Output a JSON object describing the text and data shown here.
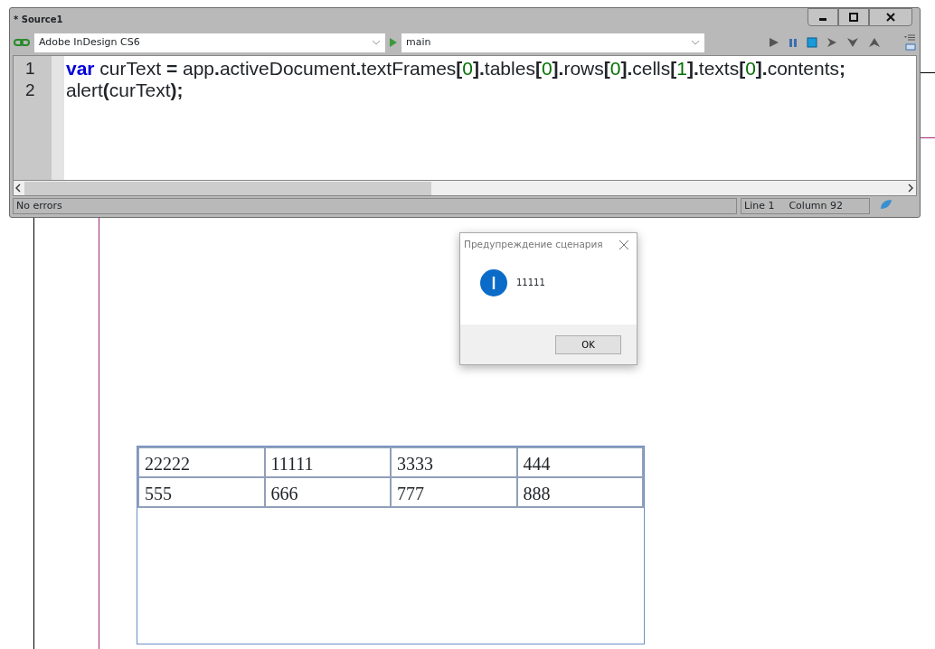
{
  "editor_window": {
    "title": "* Source1",
    "target_app": {
      "value": "Adobe InDesign CS6"
    },
    "function": {
      "value": "main"
    },
    "code_lines": [
      {
        "number": "1",
        "tokens": [
          {
            "text": "var",
            "kind": "keyword"
          },
          {
            "text": " curText ",
            "kind": "plain"
          },
          {
            "text": "=",
            "kind": "punct"
          },
          {
            "text": " app",
            "kind": "plain"
          },
          {
            "text": ".",
            "kind": "punct"
          },
          {
            "text": "activeDocument",
            "kind": "plain"
          },
          {
            "text": ".",
            "kind": "punct"
          },
          {
            "text": "textFrames",
            "kind": "plain"
          },
          {
            "text": "[",
            "kind": "punct"
          },
          {
            "text": "0",
            "kind": "number"
          },
          {
            "text": "].",
            "kind": "punct"
          },
          {
            "text": "tables",
            "kind": "plain"
          },
          {
            "text": "[",
            "kind": "punct"
          },
          {
            "text": "0",
            "kind": "number"
          },
          {
            "text": "].",
            "kind": "punct"
          },
          {
            "text": "rows",
            "kind": "plain"
          },
          {
            "text": "[",
            "kind": "punct"
          },
          {
            "text": "0",
            "kind": "number"
          },
          {
            "text": "].",
            "kind": "punct"
          },
          {
            "text": "cells",
            "kind": "plain"
          },
          {
            "text": "[",
            "kind": "punct"
          },
          {
            "text": "1",
            "kind": "number"
          },
          {
            "text": "].",
            "kind": "punct"
          },
          {
            "text": "texts",
            "kind": "plain"
          },
          {
            "text": "[",
            "kind": "punct"
          },
          {
            "text": "0",
            "kind": "number"
          },
          {
            "text": "].",
            "kind": "punct"
          },
          {
            "text": "contents",
            "kind": "plain"
          },
          {
            "text": ";",
            "kind": "punct"
          }
        ]
      },
      {
        "number": "2",
        "tokens": [
          {
            "text": "alert",
            "kind": "plain"
          },
          {
            "text": "(",
            "kind": "punct"
          },
          {
            "text": "curText",
            "kind": "plain"
          },
          {
            "text": ");",
            "kind": "punct"
          }
        ]
      }
    ],
    "status_bar": {
      "message": "No errors",
      "line": "Line 1",
      "column": "Column 92"
    }
  },
  "alert_dialog": {
    "title": "Предупреждение сценария",
    "message": "11111",
    "button": "OK"
  },
  "document_table": {
    "rows": [
      [
        "22222",
        "11111",
        "3333",
        "444"
      ],
      [
        "555",
        "666",
        "777",
        "888"
      ]
    ]
  }
}
